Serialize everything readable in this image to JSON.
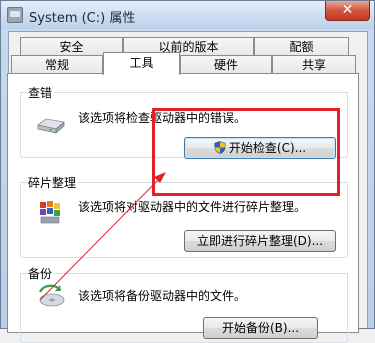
{
  "window": {
    "title": "System (C:) 属性",
    "close_label": "✕"
  },
  "tabs": {
    "row1": [
      "安全",
      "以前的版本",
      "配额"
    ],
    "row2": [
      "常规",
      "工具",
      "硬件",
      "共享"
    ],
    "active": "工具"
  },
  "error_check": {
    "label": "查错",
    "description": "该选项将检查驱动器中的错误。",
    "button": "开始检查(C)..."
  },
  "defrag": {
    "label": "碎片整理",
    "description": "该选项将对驱动器中的文件进行碎片整理。",
    "button": "立即进行碎片整理(D)..."
  },
  "backup": {
    "label": "备份",
    "description": "该选项将备份驱动器中的文件。",
    "button": "开始备份(B)..."
  },
  "colors": {
    "annotation": "#e2202a",
    "shield_blue": "#2f63b8",
    "shield_yellow": "#f2c12e"
  },
  "icons": [
    "drive-icon",
    "defrag-icon",
    "backup-icon",
    "uac-shield-icon",
    "close-icon"
  ]
}
